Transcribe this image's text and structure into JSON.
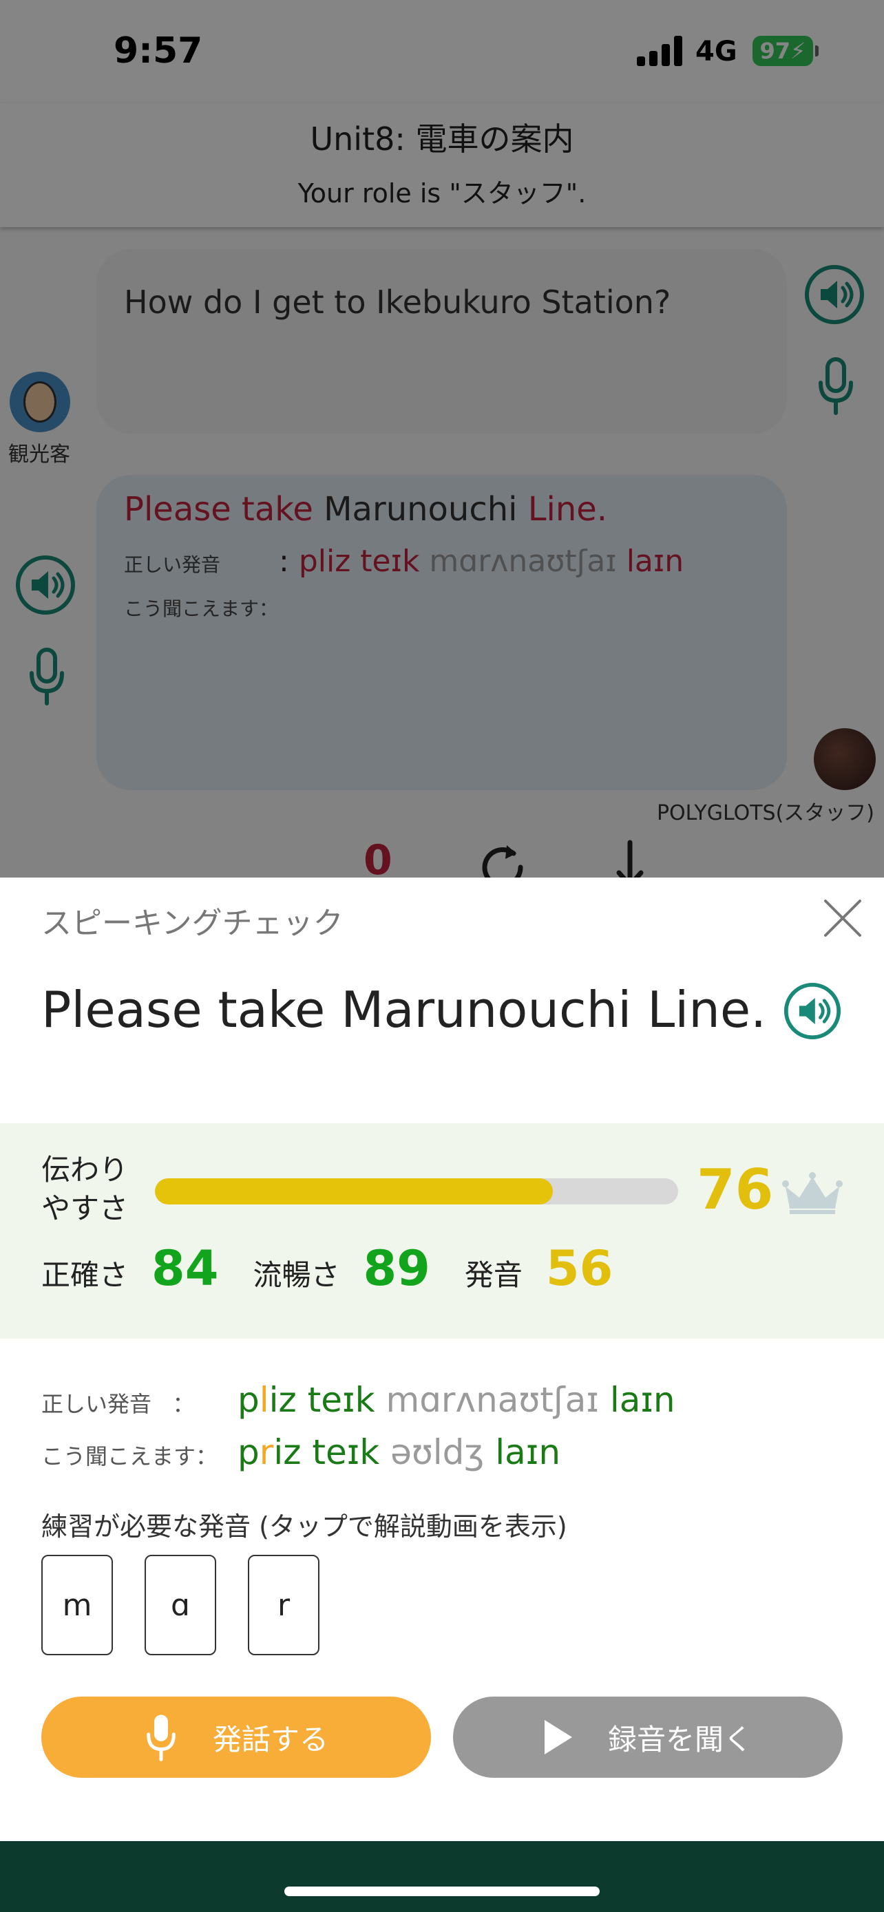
{
  "status_bar": {
    "time": "9:57",
    "network": "4G",
    "battery": "97"
  },
  "header": {
    "unit_title": "Unit8: 電車の案内",
    "role_text": "Your role is \"スタッフ\"."
  },
  "chat": {
    "message1": {
      "text": "How do I get to Ikebukuro Station?",
      "speaker": "観光客"
    },
    "message2": {
      "words": [
        "Please take",
        " Marunouchi ",
        "Line."
      ],
      "correct_label": "正しい発音",
      "correct_phonetic": [
        "pliz teɪk",
        " mɑrʌnaʊtʃaɪ ",
        "laɪn"
      ],
      "heard_label": "こう聞こえます：",
      "speaker": "POLYGLOTS(スタッフ)"
    },
    "controls": {
      "count": "0"
    }
  },
  "sheet": {
    "title": "スピーキングチェック",
    "sentence": "Please take Marunouchi Line.",
    "score_label": "伝わりやすさ",
    "score": "76",
    "score_level": 0.76,
    "accuracy_label": "正確さ",
    "accuracy": "84",
    "fluency_label": "流暢さ",
    "fluency": "89",
    "pronunciation_label": "発音",
    "pronunciation": "56",
    "correct_label": "正しい発音",
    "correct_parts": [
      "p",
      "l",
      "iz teɪk",
      " mɑrʌnaʊtʃaɪ ",
      "laɪn"
    ],
    "heard_label": "こう聞こえます：",
    "heard_parts": [
      "p",
      "r",
      "iz teɪk",
      " əʊldʒ ",
      "laɪn"
    ],
    "practice_label": "練習が必要な発音 (タップで解説動画を表示)",
    "practice_sounds": [
      "m",
      "ɑ",
      "r"
    ],
    "speak_button": "発話する",
    "listen_button": "録音を聞く"
  },
  "colors": {
    "accent_teal": "#1a8a78",
    "score_yellow": "#e2bf0c",
    "score_green": "#12a41c",
    "error_red": "#c0213f",
    "speak_orange": "#f8ad39"
  }
}
